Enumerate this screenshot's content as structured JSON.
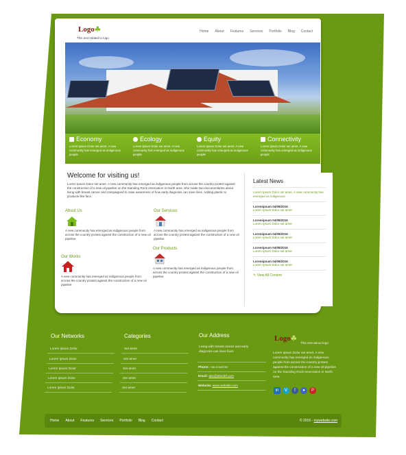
{
  "header": {
    "logo": "Logo",
    "logo_mark": "☘",
    "tagline": "This text related to logo",
    "nav": [
      "Home",
      "About",
      "Features",
      "Services",
      "Portfolio",
      "Blog",
      "Contact"
    ]
  },
  "features": [
    {
      "title": "Economy",
      "icon": "bar-chart-icon",
      "desc": "Lorem Ipsum Dolor set amet. A new community has emerged as indigenous people"
    },
    {
      "title": "Ecology",
      "icon": "leaf-circle-icon",
      "desc": "Lorem Ipsum Dolor set amet. A new community has emerged as indigenous people"
    },
    {
      "title": "Equity",
      "icon": "gear-icon",
      "desc": "Lorem Ipsum Dolor set amet. A new community has emerged as indigenous people"
    },
    {
      "title": "Connectivity",
      "icon": "users-icon",
      "desc": "Lorem Ipsum Dolor set amet. A new community has emerged as indigenous people"
    }
  ],
  "welcome": {
    "title": "Welcome for visiting us!",
    "body": "Lorem Ipsum Dolor set amet. A new community has emerged as indigenous people from across the country protest against the construction of a new oil pipeline on the Standing Rock reservation in North area. She made two documentaries about living with breast cancer and campaigned to raise awareness of how early diagnosis can save lives. Adding plastic to products like face."
  },
  "sections": {
    "about": {
      "title": "About Us",
      "desc": "A new community has emerged as indigenous people from across the country protest against the construction of a new oil pipeline"
    },
    "services": {
      "title": "Our Services",
      "desc": "A new community has emerged as indigenous people from across the country protest against the construction of a new oil pipeline"
    },
    "works": {
      "title": "Our Works",
      "desc": "A new community has emerged as indigenous people from across the country protest against the construction of a new oil pipeline"
    },
    "products": {
      "title": "Our Products",
      "desc": "A new community has emerged as indigenous people from across the country protest against the construction of a new oil pipeline"
    }
  },
  "news": {
    "title": "Latest News",
    "lead": "Lorem Ipsum Dolor set amet. A new community has emerged as indigenous",
    "items": [
      {
        "date": "Loremipsum 04/08/2016",
        "text": "Lorem Ipsum Dolor set amet"
      },
      {
        "date": "Loremipsum 04/08/2016",
        "text": "Lorem Ipsum Dolor set amet"
      },
      {
        "date": "Loremipsum 04/08/2016",
        "text": "Lorem Ipsum Dolor set amet"
      },
      {
        "date": "Loremipsum 04/08/2016",
        "text": "Lorem Ipsum Dolor set amet"
      },
      {
        "date": "Loremipsum 04/08/2016",
        "text": "Lorem Ipsum Dolor set amet"
      }
    ],
    "view_all": "View All Content"
  },
  "footer": {
    "networks": {
      "title": "Our Networks",
      "items": [
        "Lorem Ipsum Dolor",
        "Lorem Ipsum Dolor",
        "Lorem Ipsum Dolor",
        "Lorem Ipsum Dolor",
        "Lorem Ipsum Dolor"
      ]
    },
    "categories": {
      "title": "Categories",
      "items": [
        "Set amet",
        "Set amet",
        "Set amet",
        "Set amet",
        "Set amet"
      ]
    },
    "address": {
      "title": "Our Address",
      "text": "Living with breast cancer and early diagnosis can save lives",
      "phone_label": "Phone:",
      "phone": "+86 42346780",
      "email_label": "Email:",
      "email": "abc@abcdef.com",
      "website_label": "Website:",
      "website": "www.website.com"
    },
    "about": {
      "logo": "Logo",
      "tagline": "This text about logo",
      "text": "Lorem Ipsum Dolor set amet. A new community has emerged as indigenous people from across the country protest against the construction of a new oil pipeline on the Standing Rock reservation in North area."
    },
    "social": [
      {
        "icon": "linkedin-icon",
        "glyph": "in",
        "color": "#1d6fb8"
      },
      {
        "icon": "vimeo-icon",
        "glyph": "V",
        "color": "#19a3d6"
      },
      {
        "icon": "facebook-icon",
        "glyph": "f",
        "color": "#3b5998"
      },
      {
        "icon": "flickr-icon",
        "glyph": "●",
        "color": "#3d63c4"
      },
      {
        "icon": "pinterest-icon",
        "glyph": "P",
        "color": "#cb2027"
      }
    ],
    "bottom_nav": [
      "Home",
      "About",
      "Features",
      "Services",
      "Portfolio",
      "Blog",
      "Contact"
    ],
    "copyright": "© 2016 - ",
    "copyright_link": "mywebsite.com"
  }
}
